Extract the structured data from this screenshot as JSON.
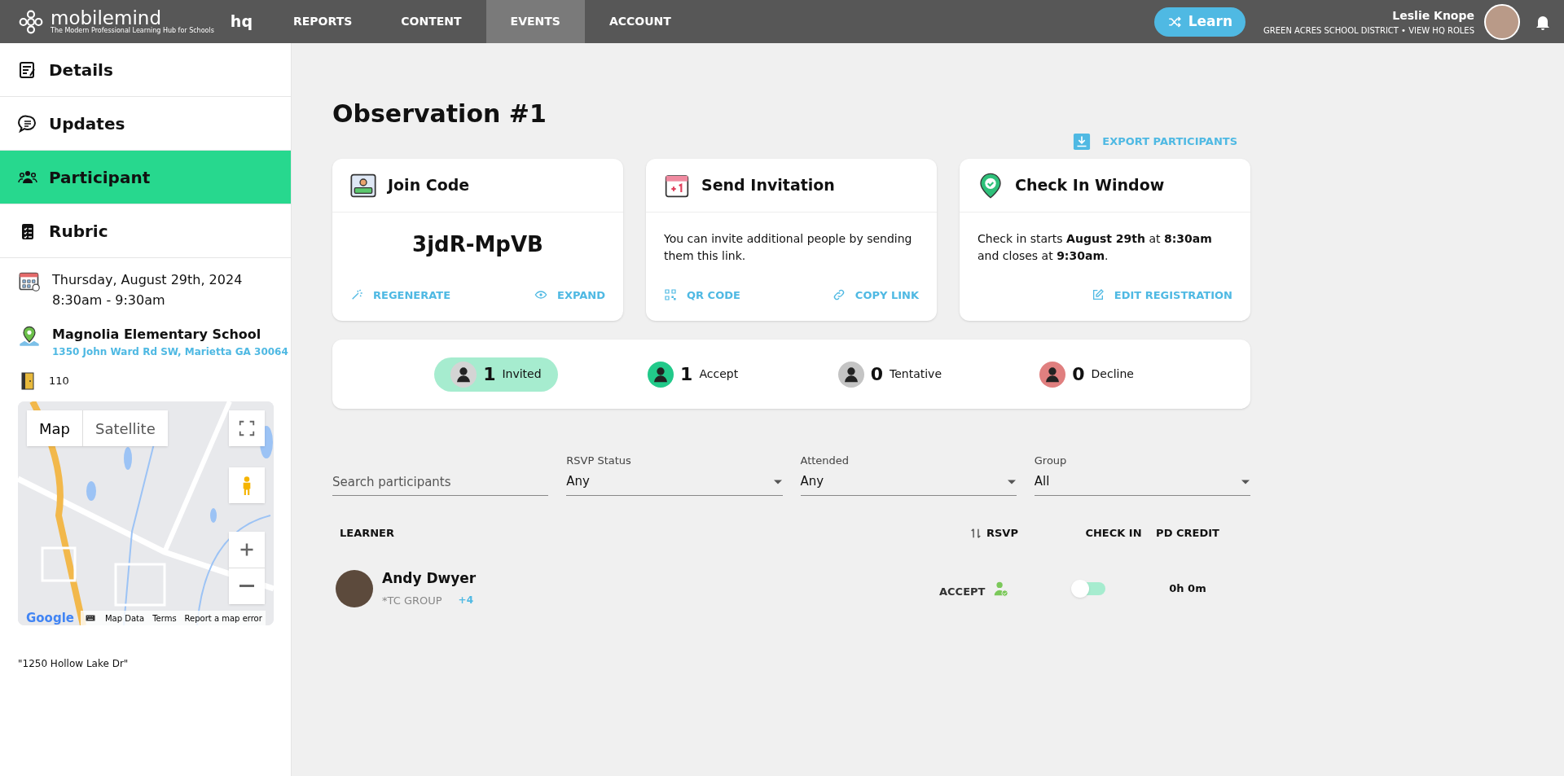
{
  "brand": {
    "name": "mobilemind",
    "tagline": "The Modern Professional Learning Hub for Schools",
    "suffix": "hq"
  },
  "nav": [
    {
      "label": "REPORTS",
      "selected": false
    },
    {
      "label": "CONTENT",
      "selected": false
    },
    {
      "label": "EVENTS",
      "selected": true
    },
    {
      "label": "ACCOUNT",
      "selected": false
    }
  ],
  "learn_button": "Learn",
  "user": {
    "name": "Leslie Knope",
    "org": "GREEN ACRES SCHOOL DISTRICT • VIEW HQ ROLES"
  },
  "sidebar": {
    "items": [
      {
        "label": "Details",
        "kind": "details",
        "selected": false
      },
      {
        "label": "Updates",
        "kind": "updates",
        "selected": false
      },
      {
        "label": "Participant",
        "kind": "participant",
        "selected": true
      },
      {
        "label": "Rubric",
        "kind": "rubric",
        "selected": false
      }
    ],
    "date": "Thursday, August 29th, 2024",
    "time": "8:30am - 9:30am",
    "school": "Magnolia Elementary School",
    "address": "1350 John Ward Rd SW, Marietta GA 30064",
    "room": "110",
    "map": {
      "tabs": [
        {
          "label": "Map",
          "selected": true
        },
        {
          "label": "Satellite",
          "selected": false
        }
      ],
      "logo": "Google",
      "footer": [
        "Map Data",
        "Terms",
        "Report a map error"
      ]
    },
    "note": "\"1250 Hollow Lake Dr\""
  },
  "title": "Observation #1",
  "export_button": "EXPORT PARTICIPANTS",
  "cards": [
    {
      "kind": "code",
      "title": "Join Code",
      "code": "3jdR-MpVB",
      "actions": [
        {
          "label": "REGENERATE",
          "kind": "wand"
        },
        {
          "label": "EXPAND",
          "kind": "eye"
        }
      ]
    },
    {
      "kind": "text",
      "title": "Send Invitation",
      "text": "You can invite additional people by sending them this link.",
      "actions": [
        {
          "label": "QR CODE",
          "kind": "qr"
        },
        {
          "label": "COPY LINK",
          "kind": "link"
        }
      ]
    },
    {
      "kind": "text",
      "title": "Check In Window",
      "text": "Check in starts **August 29th** at **8:30am** and closes at **9:30am**.",
      "actions": [
        {
          "label": "EDIT REGISTRATION",
          "kind": "edit"
        }
      ]
    }
  ],
  "stats": [
    {
      "count": "1",
      "label": "Invited",
      "color": "#d4d4d4",
      "selected": true
    },
    {
      "count": "1",
      "label": "Accept",
      "color": "#22c98a",
      "selected": false
    },
    {
      "count": "0",
      "label": "Tentative",
      "color": "#c4c4c4",
      "selected": false
    },
    {
      "count": "0",
      "label": "Decline",
      "color": "#e07f7f",
      "selected": false
    }
  ],
  "filters": {
    "search_placeholder": "Search participants",
    "selects": [
      {
        "label": "RSVP Status",
        "value": "Any"
      },
      {
        "label": "Attended",
        "value": "Any"
      },
      {
        "label": "Group",
        "value": "All"
      }
    ]
  },
  "table": {
    "columns": [
      "LEARNER",
      "RSVP",
      "CHECK IN",
      "PD CREDIT"
    ],
    "rows": [
      {
        "name": "Andy Dwyer",
        "group": "*TC GROUP",
        "more": "+4",
        "rsvp": "ACCEPT",
        "checked_in": false,
        "credit": "0h 0m"
      }
    ]
  }
}
